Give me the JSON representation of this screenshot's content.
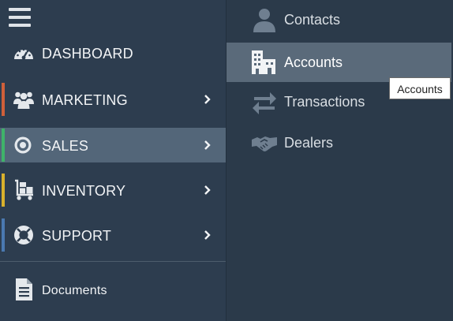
{
  "sidebar": {
    "menu_icon": "hamburger-menu-icon",
    "items": [
      {
        "label": "DASHBOARD",
        "icon": "speedometer-icon",
        "accent": "",
        "has_submenu": false,
        "active": false
      },
      {
        "label": "MARKETING",
        "icon": "people-group-icon",
        "accent": "#d0603a",
        "has_submenu": true,
        "active": false
      },
      {
        "label": "SALES",
        "icon": "target-icon",
        "accent": "#3fb36a",
        "has_submenu": true,
        "active": true
      },
      {
        "label": "INVENTORY",
        "icon": "dolly-boxes-icon",
        "accent": "#d9b12c",
        "has_submenu": true,
        "active": false
      },
      {
        "label": "SUPPORT",
        "icon": "life-ring-icon",
        "accent": "#4a79b0",
        "has_submenu": true,
        "active": false
      }
    ],
    "footer_item": {
      "label": "Documents",
      "icon": "document-icon"
    }
  },
  "submenu": {
    "items": [
      {
        "label": "Contacts",
        "icon": "person-icon",
        "active": false
      },
      {
        "label": "Accounts",
        "icon": "building-icon",
        "active": true
      },
      {
        "label": "Transactions",
        "icon": "exchange-arrows-icon",
        "active": false
      },
      {
        "label": "Dealers",
        "icon": "handshake-icon",
        "active": false
      }
    ]
  },
  "tooltip": {
    "text": "Accounts"
  }
}
